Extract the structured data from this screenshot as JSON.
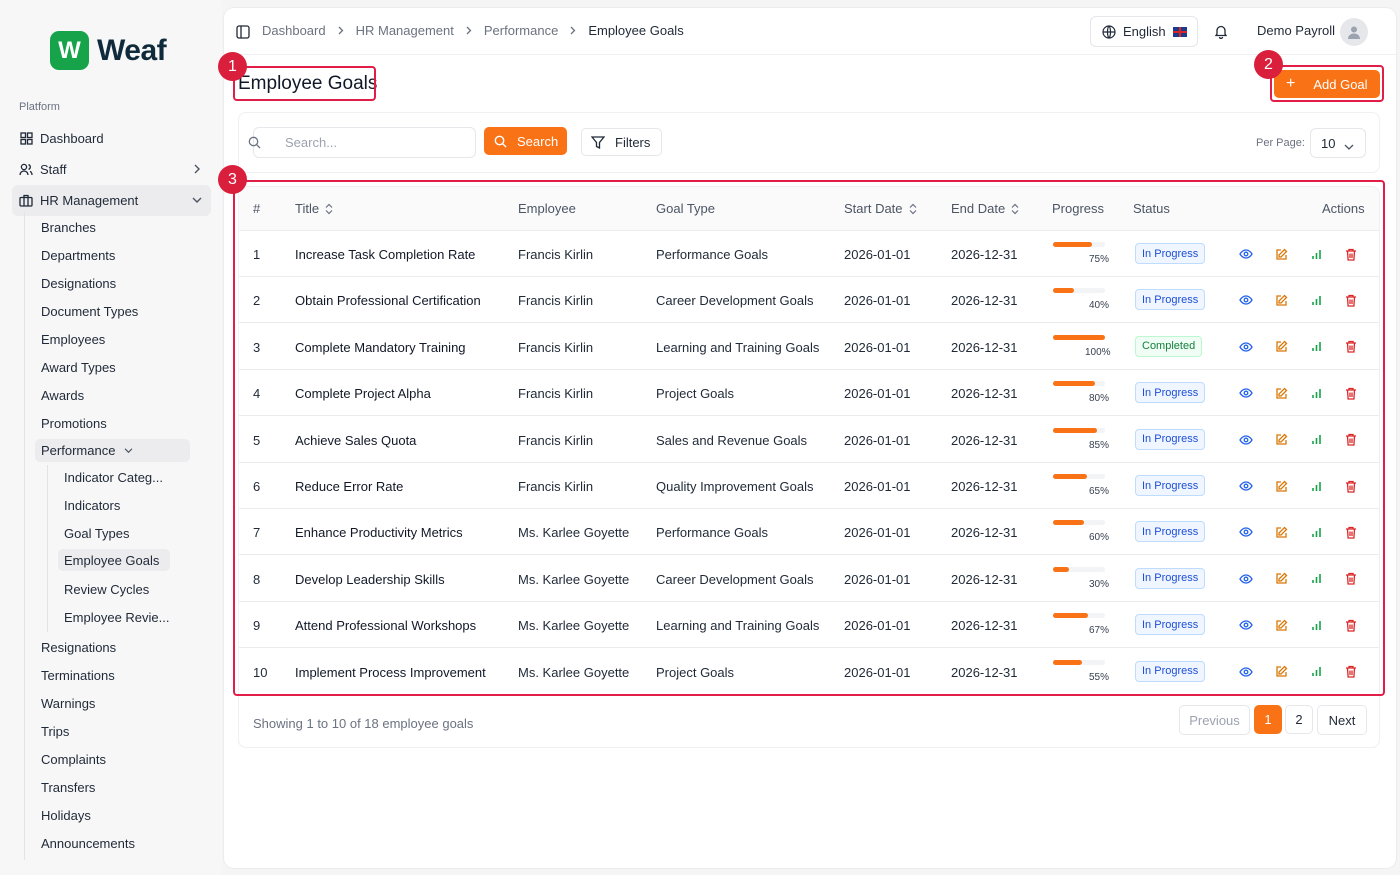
{
  "brand": {
    "logo_letter": "W",
    "name": "Weaf",
    "color": "#16a34a"
  },
  "sidebar": {
    "section_label": "Platform",
    "top_items": [
      {
        "label": "Dashboard",
        "icon": "grid-icon"
      },
      {
        "label": "Staff",
        "icon": "users-icon"
      },
      {
        "label": "HR Management",
        "icon": "briefcase-icon"
      }
    ],
    "hr_items": [
      "Branches",
      "Departments",
      "Designations",
      "Document Types",
      "Employees",
      "Award Types",
      "Awards",
      "Promotions"
    ],
    "performance_label": "Performance",
    "performance_items": [
      "Indicator Categ...",
      "Indicators",
      "Goal Types",
      "Employee Goals",
      "Review Cycles",
      "Employee Revie..."
    ],
    "after_items": [
      "Resignations",
      "Terminations",
      "Warnings",
      "Trips",
      "Complaints",
      "Transfers",
      "Holidays",
      "Announcements"
    ]
  },
  "header": {
    "breadcrumbs": [
      "Dashboard",
      "HR Management",
      "Performance",
      "Employee Goals"
    ],
    "language": "English",
    "user_name": "Demo Payroll"
  },
  "page": {
    "title": "Employee Goals",
    "add_button": "Add Goal"
  },
  "filters": {
    "search_placeholder": "Search...",
    "search_button": "Search",
    "filters_button": "Filters",
    "per_page_label": "Per Page:",
    "per_page_value": "10"
  },
  "table": {
    "headers": {
      "num": "#",
      "title": "Title",
      "employee": "Employee",
      "goal_type": "Goal Type",
      "start_date": "Start Date",
      "end_date": "End Date",
      "progress": "Progress",
      "status": "Status",
      "actions": "Actions"
    },
    "rows": [
      {
        "num": "1",
        "title": "Increase Task Completion Rate",
        "employee": "Francis Kirlin",
        "goal_type": "Performance Goals",
        "start": "2026-01-01",
        "end": "2026-12-31",
        "progress": 75,
        "progress_label": "75%",
        "status": "In Progress"
      },
      {
        "num": "2",
        "title": "Obtain Professional Certification",
        "employee": "Francis Kirlin",
        "goal_type": "Career Development Goals",
        "start": "2026-01-01",
        "end": "2026-12-31",
        "progress": 40,
        "progress_label": "40%",
        "status": "In Progress"
      },
      {
        "num": "3",
        "title": "Complete Mandatory Training",
        "employee": "Francis Kirlin",
        "goal_type": "Learning and Training Goals",
        "start": "2026-01-01",
        "end": "2026-12-31",
        "progress": 100,
        "progress_label": "100%",
        "status": "Completed"
      },
      {
        "num": "4",
        "title": "Complete Project Alpha",
        "employee": "Francis Kirlin",
        "goal_type": "Project Goals",
        "start": "2026-01-01",
        "end": "2026-12-31",
        "progress": 80,
        "progress_label": "80%",
        "status": "In Progress"
      },
      {
        "num": "5",
        "title": "Achieve Sales Quota",
        "employee": "Francis Kirlin",
        "goal_type": "Sales and Revenue Goals",
        "start": "2026-01-01",
        "end": "2026-12-31",
        "progress": 85,
        "progress_label": "85%",
        "status": "In Progress"
      },
      {
        "num": "6",
        "title": "Reduce Error Rate",
        "employee": "Francis Kirlin",
        "goal_type": "Quality Improvement Goals",
        "start": "2026-01-01",
        "end": "2026-12-31",
        "progress": 65,
        "progress_label": "65%",
        "status": "In Progress"
      },
      {
        "num": "7",
        "title": "Enhance Productivity Metrics",
        "employee": "Ms. Karlee Goyette",
        "goal_type": "Performance Goals",
        "start": "2026-01-01",
        "end": "2026-12-31",
        "progress": 60,
        "progress_label": "60%",
        "status": "In Progress"
      },
      {
        "num": "8",
        "title": "Develop Leadership Skills",
        "employee": "Ms. Karlee Goyette",
        "goal_type": "Career Development Goals",
        "start": "2026-01-01",
        "end": "2026-12-31",
        "progress": 30,
        "progress_label": "30%",
        "status": "In Progress"
      },
      {
        "num": "9",
        "title": "Attend Professional Workshops",
        "employee": "Ms. Karlee Goyette",
        "goal_type": "Learning and Training Goals",
        "start": "2026-01-01",
        "end": "2026-12-31",
        "progress": 67,
        "progress_label": "67%",
        "status": "In Progress"
      },
      {
        "num": "10",
        "title": "Implement Process Improvement",
        "employee": "Ms. Karlee Goyette",
        "goal_type": "Project Goals",
        "start": "2026-01-01",
        "end": "2026-12-31",
        "progress": 55,
        "progress_label": "55%",
        "status": "In Progress"
      }
    ]
  },
  "pagination": {
    "summary": "Showing 1 to 10 of 18 employee goals",
    "previous": "Previous",
    "pages": [
      "1",
      "2"
    ],
    "next": "Next"
  },
  "annotations": [
    "1",
    "2",
    "3"
  ],
  "colors": {
    "accent": "#f97316",
    "annotation": "#e11d48",
    "status_progress": "#1d4ed8",
    "status_done": "#15803d"
  }
}
